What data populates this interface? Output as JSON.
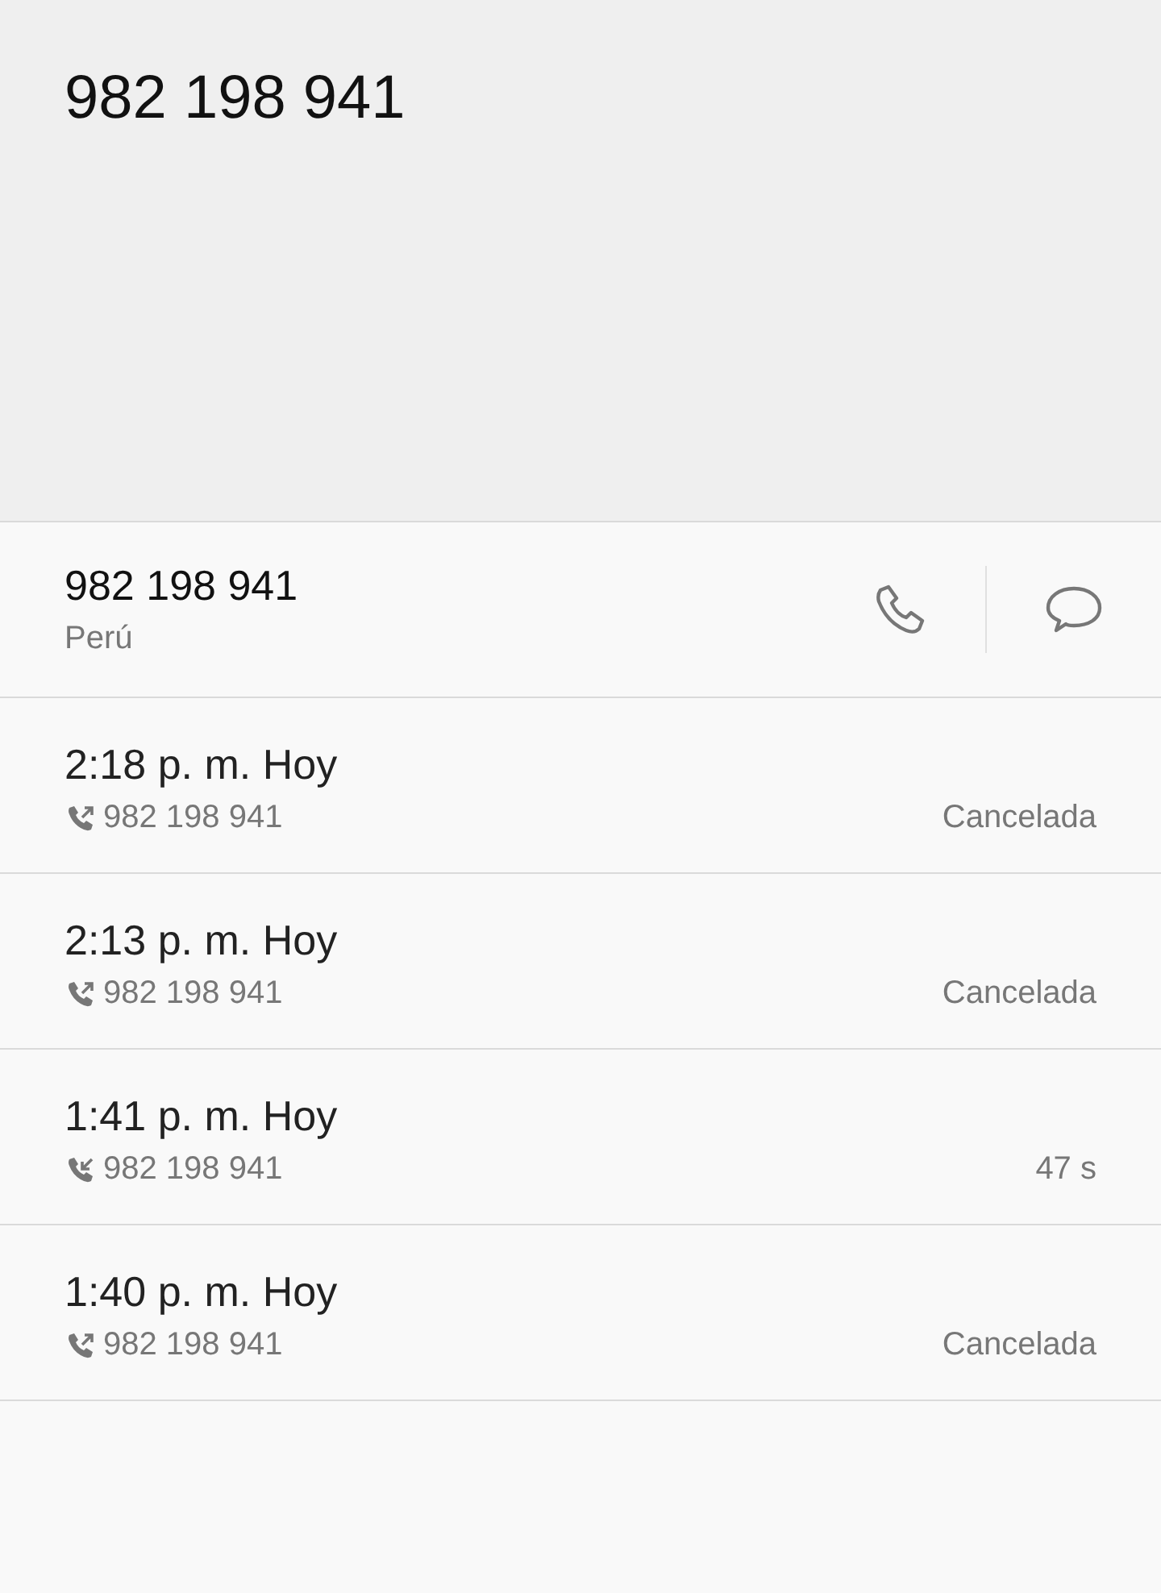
{
  "header": {
    "title": "982 198 941"
  },
  "contact": {
    "number": "982 198 941",
    "location": "Perú"
  },
  "calls": [
    {
      "time": "2:18 p. m. Hoy",
      "kind": "outgoing",
      "number": "982 198 941",
      "status": "Cancelada"
    },
    {
      "time": "2:13 p. m. Hoy",
      "kind": "outgoing",
      "number": "982 198 941",
      "status": "Cancelada"
    },
    {
      "time": "1:41 p. m. Hoy",
      "kind": "incoming",
      "number": "982 198 941",
      "status": "47 s"
    },
    {
      "time": "1:40 p. m. Hoy",
      "kind": "outgoing",
      "number": "982 198 941",
      "status": "Cancelada"
    }
  ]
}
